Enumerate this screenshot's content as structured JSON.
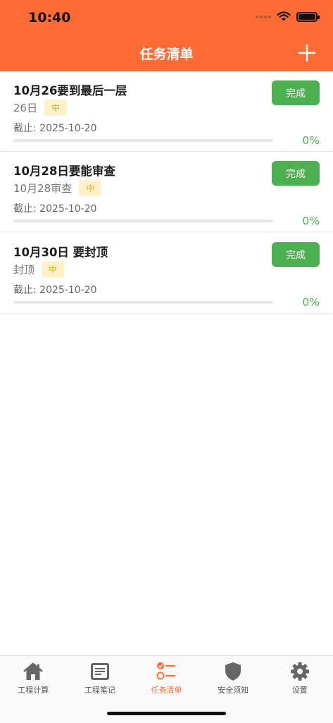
{
  "status_bar": {
    "time": "10:40"
  },
  "header": {
    "title": "任务清单",
    "add_icon": "plus-icon"
  },
  "tasks": [
    {
      "title": "10月26要到最后一层",
      "desc": "26日",
      "priority": "中",
      "due": "截止: 2025-10-20",
      "progress": 0,
      "progress_text": "0%",
      "action": "完成"
    },
    {
      "title": "10月28日要能审查",
      "desc": "10月28审查",
      "priority": "中",
      "due": "截止: 2025-10-20",
      "progress": 0,
      "progress_text": "0%",
      "action": "完成"
    },
    {
      "title": "10月30日 要封顶",
      "desc": "封顶",
      "priority": "中",
      "due": "截止: 2025-10-20",
      "progress": 0,
      "progress_text": "0%",
      "action": "完成"
    }
  ],
  "tabbar": {
    "active": 2,
    "items": [
      {
        "label": "工程计算",
        "icon": "home-icon"
      },
      {
        "label": "工程笔记",
        "icon": "note-icon"
      },
      {
        "label": "任务清单",
        "icon": "checklist-icon"
      },
      {
        "label": "安全须知",
        "icon": "shield-icon"
      },
      {
        "label": "设置",
        "icon": "gear-icon"
      }
    ]
  },
  "colors": {
    "accent": "#ff6b35",
    "success": "#4caf50",
    "badge_bg": "#fff1c9",
    "badge_text": "#e6a817"
  }
}
